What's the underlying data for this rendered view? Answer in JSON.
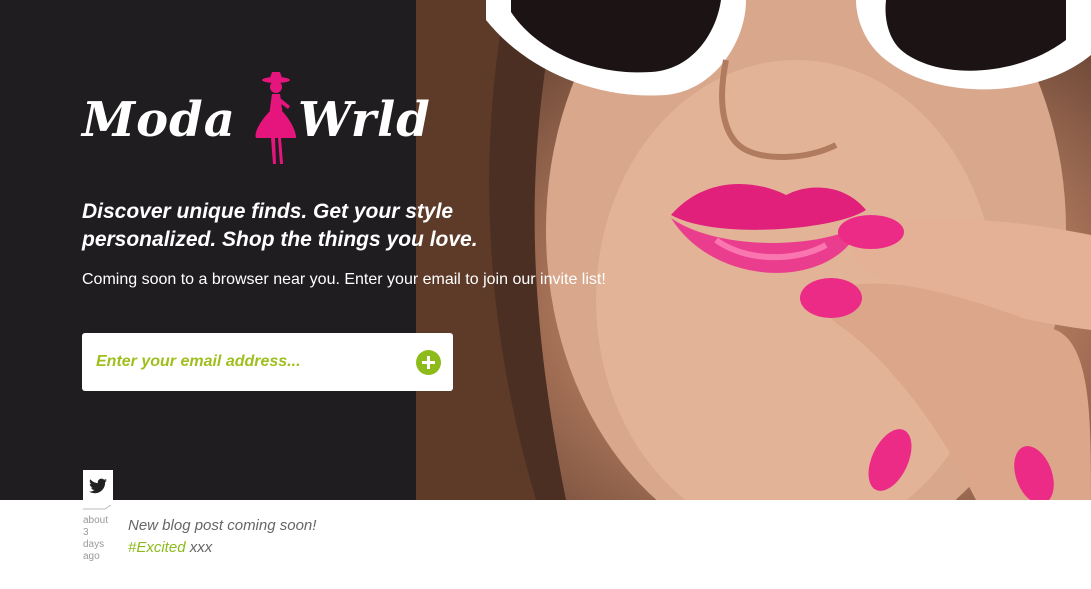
{
  "brand": {
    "word_left": "Moda",
    "word_right": "Wrld"
  },
  "hero": {
    "tagline_line1": "Discover unique finds. Get your style",
    "tagline_line2": "personalized. Shop the things you love.",
    "subline": "Coming soon to a browser near you. Enter your email to join our invite list!"
  },
  "signup": {
    "placeholder": "Enter your email address...",
    "submit_icon": "plus-circle-icon"
  },
  "tweet": {
    "icon": "twitter-bird-icon",
    "time_lines": [
      "about",
      "3",
      "days",
      "ago"
    ],
    "text": "New blog post coming soon!",
    "hashtag": "#Excited",
    "suffix": "xxx"
  },
  "colors": {
    "accent": "#8dbb1b",
    "dark_panel": "#201d20",
    "logo_figure": "#e6157d"
  }
}
